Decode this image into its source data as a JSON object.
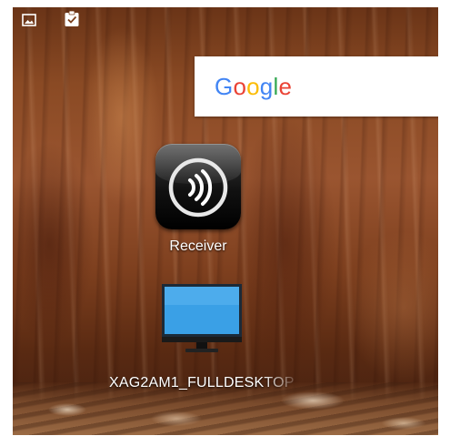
{
  "status_bar": {
    "icons": [
      "gallery-icon",
      "clipboard-check-icon"
    ]
  },
  "search_widget": {
    "logo_letters": [
      {
        "char": "G",
        "color": "#4285F4"
      },
      {
        "char": "o",
        "color": "#EA4335"
      },
      {
        "char": "o",
        "color": "#FBBC05"
      },
      {
        "char": "g",
        "color": "#4285F4"
      },
      {
        "char": "l",
        "color": "#34A853"
      },
      {
        "char": "e",
        "color": "#EA4335"
      }
    ]
  },
  "home_screen": {
    "shortcuts": [
      {
        "label": "Receiver",
        "icon": "citrix-receiver-icon"
      },
      {
        "label": "XAG2AM1_FULLDESKTOP",
        "icon": "desktop-monitor-icon"
      }
    ]
  },
  "colors": {
    "wallpaper_base": "#8a4a24",
    "monitor_screen": "#3aa0e6",
    "label_text": "#ffffff"
  }
}
